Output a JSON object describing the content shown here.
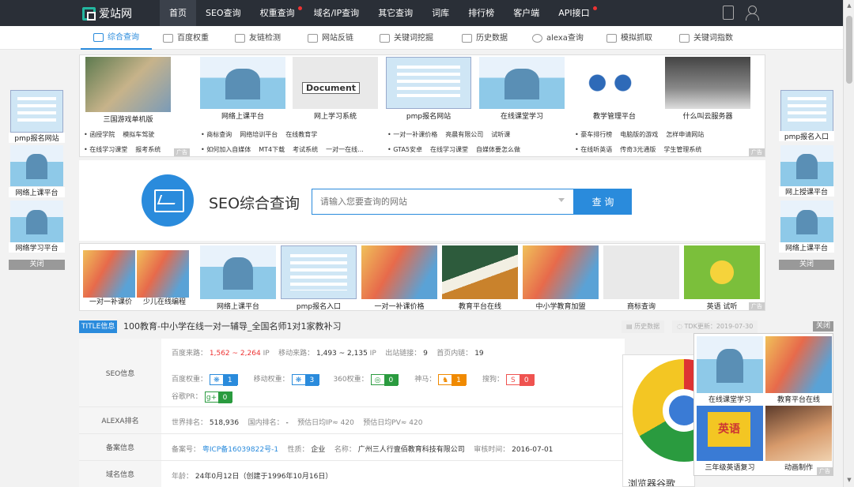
{
  "topbar": {
    "logo": "爱站网",
    "nav": [
      "首页",
      "SEO查询",
      "权重查询",
      "域名/IP查询",
      "其它查询",
      "词库",
      "排行榜",
      "客户端",
      "API接口"
    ]
  },
  "subnav": [
    "综合查询",
    "百度权重",
    "友链检测",
    "网站反链",
    "关键词挖掘",
    "历史数据",
    "alexa查询",
    "模拟抓取",
    "关键词指数"
  ],
  "top_banner": {
    "captions": [
      "三国游戏单机版",
      "网络上课平台",
      "网上学习系统",
      "pmp报名网站",
      "在线课堂学习",
      "教学管理平台",
      "什么叫云服务器"
    ],
    "doc_label": "Document",
    "links_row1": [
      [
        "函授学院",
        "模拟车驾驶"
      ],
      [
        "商标查询",
        "网络培训平台",
        "在线教育学"
      ],
      [
        "一对一补课价格",
        "亮晨有限公司",
        "试听课"
      ],
      [
        "豪车排行榜",
        "电脑版的游戏",
        "怎样申请网站"
      ]
    ],
    "links_row2": [
      [
        "在线学习课堂",
        "报考系统"
      ],
      [
        "如何加入自媒体",
        "MT4下载",
        "考试系统",
        "一对一在线..."
      ],
      [
        "GTA5安卓",
        "在线学习课堂",
        "自媒体要怎么做"
      ],
      [
        "在线听英语",
        "传奇3光通版",
        "学生管理系统"
      ]
    ],
    "ad_tag": "广告"
  },
  "left_side": {
    "captions": [
      "pmp报名网站",
      "网络上课平台",
      "网络学习平台"
    ],
    "close": "关闭"
  },
  "right_side": {
    "captions": [
      "pmp报名入口",
      "网上授课平台",
      "网络上课平台"
    ],
    "close": "关闭"
  },
  "seo": {
    "title": "SEO综合查询",
    "placeholder": "请输入您要查询的网站",
    "button": "查 询"
  },
  "mid_banner": {
    "captions": [
      "一对一补课价",
      "少儿在线编程",
      "网络上课平台",
      "pmp报名入口",
      "一对一补课价格",
      "教育平台在线",
      "中小学教育加盟",
      "商标查询",
      "英语 试听"
    ],
    "ad_tag": "广告"
  },
  "info": {
    "badge": "TITLE信息",
    "page_title": "100教育-中小学在线一对一辅导_全国名师1对1家教补习",
    "history": "历史数据",
    "tdk": "TDK更新：2019-07-30",
    "close": "关闭",
    "seo_label": "SEO信息",
    "baidu_from_label": "百度来路：",
    "baidu_from": "1,562 ~ 2,264",
    "ip": "IP",
    "mobile_from_label": "移动来路：",
    "mobile_from": "1,493 ~ 2,135",
    "outlinks_label": "出站链接：",
    "outlinks": "9",
    "inlinks_label": "首页内链：",
    "inlinks": "19",
    "baidu_weight_label": "百度权重：",
    "baidu_weight": "1",
    "mobile_weight_label": "移动权重：",
    "mobile_weight": "3",
    "w360_label": "360权重：",
    "w360": "0",
    "shenma_label": "神马：",
    "shenma": "1",
    "sogou_label": "搜狗：",
    "sogou": "0",
    "google_label": "谷歌PR：",
    "google": "0",
    "alexa_label": "ALEXA排名",
    "world_rank_label": "世界排名：",
    "world_rank": "518,936",
    "cn_rank_label": "国内排名：",
    "cn_rank": "-",
    "ip_est": "预估日均IP≈ 420",
    "pv_est": "预估日均PV≈ 420",
    "icp_label": "备案信息",
    "icp_no_label": "备案号：",
    "icp_no": "粤ICP备16039822号-1",
    "nature_label": "性质：",
    "nature": "企业",
    "name_label": "名称：",
    "name": "广州三人行壹佰教育科技有限公司",
    "audit_label": "审核时间：",
    "audit": "2016-07-01",
    "domain_label": "域名信息",
    "age_label": "年龄：",
    "age": "24年0月12日（创建于1996年10月16日）"
  },
  "chrome_ad": {
    "text": "浏览器谷歌"
  },
  "popup": {
    "captions": [
      "在线课堂学习",
      "教育平台在线",
      "三年级英语复习",
      "动画制作"
    ],
    "english_word": "英语",
    "ad_tag": "广告"
  }
}
